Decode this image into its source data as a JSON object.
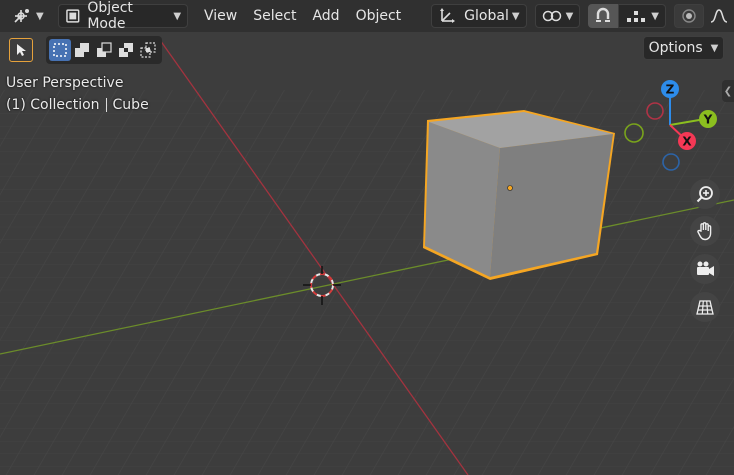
{
  "header": {
    "mode": {
      "label": "Object Mode",
      "icon": "object-mode-icon"
    },
    "menus": [
      "View",
      "Select",
      "Add",
      "Object"
    ],
    "transform_orientation": {
      "label": "Global"
    },
    "editor_type_icon": "editor-type-icon"
  },
  "toolbar": {
    "options_label": "Options",
    "selection_modes": [
      "select-box",
      "extend",
      "subtract",
      "invert",
      "intersect"
    ]
  },
  "viewport": {
    "perspective_label": "User Perspective",
    "collection_label": "(1) Collection",
    "object_label": "Cube"
  },
  "gizmo": {
    "z_label": "Z",
    "y_label": "Y",
    "x_label": "X",
    "colors": {
      "x": "#f53855",
      "y": "#8bbf1f",
      "z": "#2d8ceb"
    }
  },
  "colors": {
    "background": "#3d3d3d",
    "header": "#303030",
    "accent": "#4772b3",
    "selection_outline": "#f5a623"
  }
}
